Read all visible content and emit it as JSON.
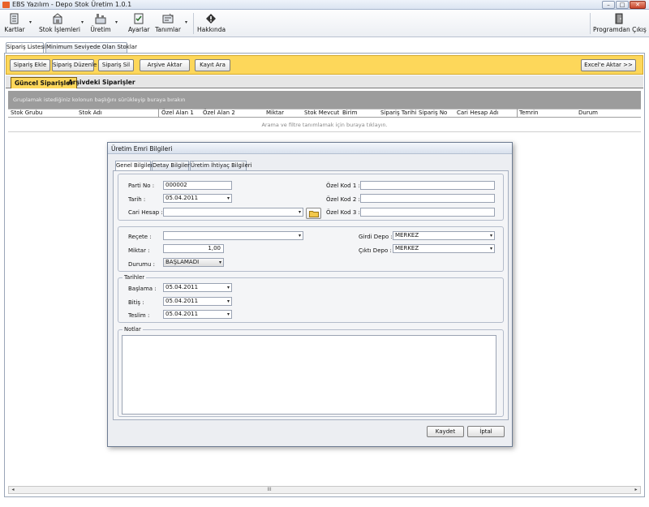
{
  "window": {
    "title": "EBS Yazılım - Depo Stok Üretim 1.0.1",
    "minimize_glyph": "–",
    "maximize_glyph": "□",
    "close_glyph": "✕"
  },
  "toolbar": {
    "items": [
      {
        "label": "Kartlar",
        "icon": "cards-icon",
        "dropdown": true
      },
      {
        "label": "Stok İşlemleri",
        "icon": "stock-icon",
        "dropdown": true
      },
      {
        "label": "Üretim",
        "icon": "production-icon",
        "dropdown": true
      },
      {
        "label": "Ayarlar",
        "icon": "settings-icon",
        "dropdown": false
      },
      {
        "label": "Tanımlar",
        "icon": "definitions-icon",
        "dropdown": true
      },
      {
        "label": "Hakkında",
        "icon": "about-icon",
        "dropdown": false
      }
    ],
    "exit_label": "Programdan Çıkış",
    "dropdown_glyph": "▾"
  },
  "page_tabs": [
    "Sipariş Listesi",
    "Minimum Seviyede Olan Stoklar"
  ],
  "actions": {
    "add": "Sipariş Ekle",
    "edit": "Sipariş Düzenle",
    "delete": "Sipariş Sil",
    "archive": "Arşive Aktar",
    "search": "Kayıt Ara",
    "excel": "Excel'e Aktar >>"
  },
  "sub_tabs": [
    "Güncel Siparişler",
    "Arşivdeki Siparişler"
  ],
  "grid": {
    "group_hint": "Gruplamak istediğiniz kolonun başlığını sürükleyip buraya bırakın",
    "columns": [
      "Stok Grubu",
      "Stok Adı",
      "Özel Alan 1",
      "Özel Alan 2",
      "Miktar",
      "Stok Mevcut",
      "Birim",
      "Sipariş Tarihi",
      "Sipariş No",
      "Cari Hesap Adı",
      "Temrin",
      "Durum"
    ],
    "filter_hint": "Arama ve filtre tanımlamak için buraya tıklayın.",
    "scroll_grip": "III",
    "scroll_left": "◂",
    "scroll_right": "▸"
  },
  "dialog": {
    "title": "Üretim Emri Bilgileri",
    "tabs": [
      "Genel Bilgiler",
      "Detay Bilgiler",
      "Üretim İhtiyaç Bilgileri"
    ],
    "parti_no_label": "Parti No :",
    "parti_no": "000002",
    "tarih_label": "Tarih :",
    "tarih": "05.04.2011",
    "cari_label": "Cari Hesap :",
    "cari": "",
    "ozel1_label": "Özel Kod 1 :",
    "ozel2_label": "Özel Kod 2 :",
    "ozel3_label": "Özel Kod 3 :",
    "ozel1": "",
    "ozel2": "",
    "ozel3": "",
    "recete_label": "Reçete :",
    "recete": "",
    "miktar_label": "Miktar :",
    "miktar": "1,00",
    "durum_label": "Durumu :",
    "durum": "BAŞLAMADI",
    "girdi_label": "Girdi Depo :",
    "girdi": "MERKEZ",
    "cikti_label": "Çıktı Depo :",
    "cikti": "MERKEZ",
    "tarihler_title": "Tarihler",
    "baslama_label": "Başlama :",
    "baslama": "05.04.2011",
    "bitis_label": "Bitiş :",
    "bitis": "05.04.2011",
    "teslim_label": "Teslim :",
    "teslim": "05.04.2011",
    "notlar_title": "Notlar",
    "notes": "",
    "save": "Kaydet",
    "cancel": "İptal",
    "arrow_glyph": "▾"
  }
}
